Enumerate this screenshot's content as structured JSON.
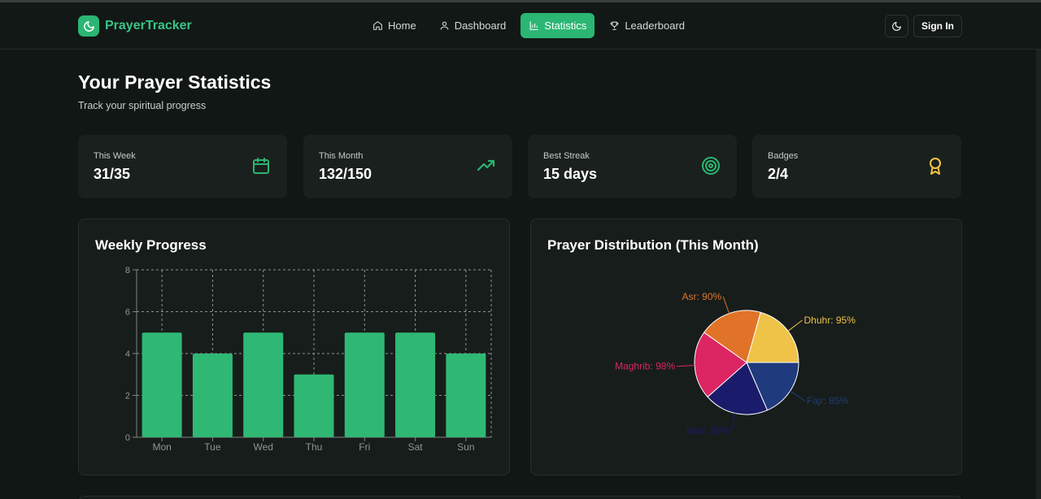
{
  "nav": {
    "brand": "PrayerTracker",
    "links": [
      {
        "label": "Home",
        "icon": "home-icon",
        "active": false
      },
      {
        "label": "Dashboard",
        "icon": "user-icon",
        "active": false
      },
      {
        "label": "Statistics",
        "icon": "bar-chart-icon",
        "active": true
      },
      {
        "label": "Leaderboard",
        "icon": "trophy-icon",
        "active": false
      }
    ],
    "theme_toggle_icon": "moon-icon",
    "signin_label": "Sign In"
  },
  "header": {
    "title": "Your Prayer Statistics",
    "subtitle": "Track your spiritual progress"
  },
  "stats": [
    {
      "label": "This Week",
      "value": "31/35",
      "icon": "calendar-icon",
      "color": "#2bb673"
    },
    {
      "label": "This Month",
      "value": "132/150",
      "icon": "trending-up-icon",
      "color": "#2bb673"
    },
    {
      "label": "Best Streak",
      "value": "15 days",
      "icon": "target-icon",
      "color": "#2bb673"
    },
    {
      "label": "Badges",
      "value": "2/4",
      "icon": "award-icon",
      "color": "#f5c542"
    }
  ],
  "weekly": {
    "title": "Weekly Progress",
    "chart_data": {
      "type": "bar",
      "categories": [
        "Mon",
        "Tue",
        "Wed",
        "Thu",
        "Fri",
        "Sat",
        "Sun"
      ],
      "values": [
        5,
        4,
        5,
        3,
        5,
        5,
        4
      ],
      "ylim": [
        0,
        8
      ],
      "yticks": [
        0,
        2,
        4,
        6,
        8
      ],
      "grid": true,
      "color": "#2fb873"
    }
  },
  "distribution": {
    "title": "Prayer Distribution (This Month)",
    "chart_data": {
      "type": "pie",
      "slices": [
        {
          "label": "Fajr: 85%",
          "value": 85,
          "color": "#1f3b7d"
        },
        {
          "label": "Isha: 92%",
          "value": 92,
          "color": "#1b1b6b"
        },
        {
          "label": "Maghrib: 98%",
          "value": 98,
          "color": "#dc2663"
        },
        {
          "label": "Asr: 90%",
          "value": 90,
          "color": "#e07328"
        },
        {
          "label": "Dhuhr: 95%",
          "value": 95,
          "color": "#efc347"
        }
      ]
    }
  }
}
